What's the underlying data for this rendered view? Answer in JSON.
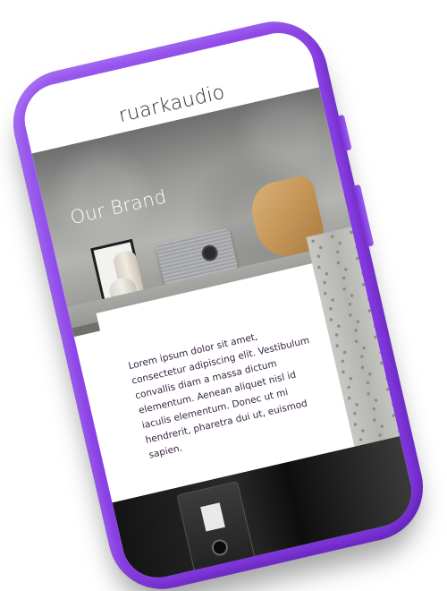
{
  "app": {
    "brand": "ruarkaudio"
  },
  "hero": {
    "title": "Our Brand"
  },
  "content": {
    "body": "Lorem ipsum dolor sit amet, consectetur adipiscing elit. Vestibulum convallis diam a massa dictum elementum. Aenean aliquet nisl id iaculis elementum. Donec ut mi hendrerit, pharetra dui ut, euismod sapien."
  },
  "colors": {
    "phone_body": "#8a40e6",
    "text": "#3a2440"
  }
}
